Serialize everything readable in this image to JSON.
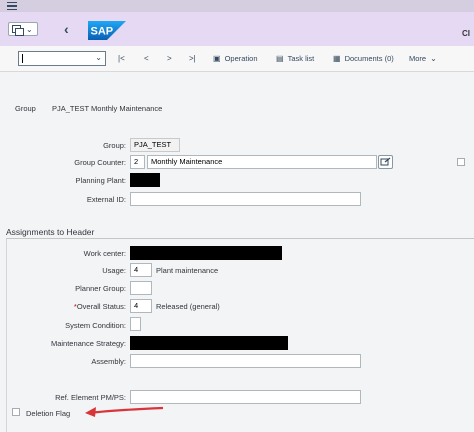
{
  "shell": {
    "back_glyph": "‹",
    "logo_text": "SAP",
    "title_cut": "CI"
  },
  "toolbar": {
    "first_glyph": "|<",
    "prev_glyph": "<",
    "next_glyph": ">",
    "last_glyph": ">|",
    "operation": "Operation",
    "task_list": "Task list",
    "documents": "Documents (0)",
    "more": "More"
  },
  "header": {
    "label": "Group",
    "value": "PJA_TEST Monthly Maintenance"
  },
  "fields": {
    "group_label": "Group:",
    "group_value": "PJA_TEST",
    "group_counter_label": "Group Counter:",
    "group_counter_value": "2",
    "group_counter_desc": "Monthly Maintenance",
    "planning_plant_label": "Planning Plant:",
    "external_id_label": "External ID:"
  },
  "assignments": {
    "title": "Assignments to Header",
    "work_center_label": "Work center:",
    "usage_label": "Usage:",
    "usage_value": "4",
    "usage_text": "Plant maintenance",
    "planner_group_label": "Planner Group:",
    "overall_status_required": "*",
    "overall_status_label": "Overall Status:",
    "overall_status_value": "4",
    "overall_status_text": "Released (general)",
    "system_condition_label": "System Condition:",
    "maintenance_strategy_label": "Maintenance Strategy:",
    "assembly_label": "Assembly:",
    "ref_element_label": "Ref. Element PM/PS:",
    "deletion_flag_label": "Deletion Flag"
  },
  "colors": {
    "shell_bg": "#e6d9f3",
    "top_strip": "#d5cde0",
    "sap_blue": "#0a6ed1",
    "annotation_arrow": "#d9343a"
  },
  "icons": [
    "menu-icon",
    "transaction-icon",
    "back-icon",
    "sap-logo",
    "first-page-icon",
    "previous-page-icon",
    "next-page-icon",
    "last-page-icon",
    "operation-icon",
    "task-list-icon",
    "documents-icon",
    "dropdown-icon",
    "search-help-icon",
    "red-arrow"
  ]
}
